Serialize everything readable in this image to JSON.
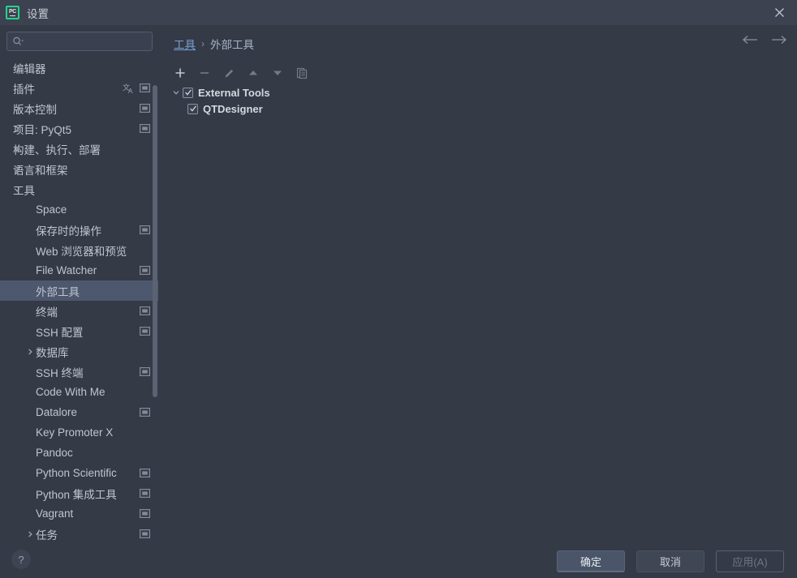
{
  "window": {
    "title": "设置",
    "app_icon": "pycharm-logo",
    "app_icon_text": "PC",
    "close_icon": "close-icon"
  },
  "search": {
    "value": "",
    "placeholder": "",
    "icon": "search-icon"
  },
  "breadcrumb": {
    "parent": "工具",
    "separator": "›",
    "current": "外部工具"
  },
  "nav": {
    "back_icon": "arrow-left-icon",
    "forward_icon": "arrow-right-icon"
  },
  "sidebar": {
    "items": [
      {
        "label": "编辑器",
        "indent": 0,
        "chevron": "none",
        "badge": false,
        "translate": false,
        "selected": false
      },
      {
        "label": "插件",
        "indent": 0,
        "chevron": "none",
        "badge": true,
        "translate": true,
        "selected": false
      },
      {
        "label": "版本控制",
        "indent": 0,
        "chevron": "collapsed",
        "badge": true,
        "translate": false,
        "selected": false
      },
      {
        "label": "项目: PyQt5",
        "indent": 0,
        "chevron": "collapsed",
        "badge": true,
        "translate": false,
        "selected": false
      },
      {
        "label": "构建、执行、部署",
        "indent": 0,
        "chevron": "collapsed",
        "badge": false,
        "translate": false,
        "selected": false
      },
      {
        "label": "语言和框架",
        "indent": 0,
        "chevron": "collapsed",
        "badge": false,
        "translate": false,
        "selected": false
      },
      {
        "label": "工具",
        "indent": 0,
        "chevron": "expanded",
        "badge": false,
        "translate": false,
        "selected": false
      },
      {
        "label": "Space",
        "indent": 1,
        "chevron": "none",
        "badge": false,
        "translate": false,
        "selected": false
      },
      {
        "label": "保存时的操作",
        "indent": 1,
        "chevron": "none",
        "badge": true,
        "translate": false,
        "selected": false
      },
      {
        "label": "Web 浏览器和预览",
        "indent": 1,
        "chevron": "none",
        "badge": false,
        "translate": false,
        "selected": false
      },
      {
        "label": "File Watcher",
        "indent": 1,
        "chevron": "none",
        "badge": true,
        "translate": false,
        "selected": false
      },
      {
        "label": "外部工具",
        "indent": 1,
        "chevron": "none",
        "badge": false,
        "translate": false,
        "selected": true
      },
      {
        "label": "终端",
        "indent": 1,
        "chevron": "none",
        "badge": true,
        "translate": false,
        "selected": false
      },
      {
        "label": "SSH 配置",
        "indent": 1,
        "chevron": "none",
        "badge": true,
        "translate": false,
        "selected": false
      },
      {
        "label": "数据库",
        "indent": 1,
        "chevron": "collapsed",
        "badge": false,
        "translate": false,
        "selected": false
      },
      {
        "label": "SSH 终端",
        "indent": 1,
        "chevron": "none",
        "badge": true,
        "translate": false,
        "selected": false
      },
      {
        "label": "Code With Me",
        "indent": 1,
        "chevron": "none",
        "badge": false,
        "translate": false,
        "selected": false
      },
      {
        "label": "Datalore",
        "indent": 1,
        "chevron": "none",
        "badge": true,
        "translate": false,
        "selected": false
      },
      {
        "label": "Key Promoter X",
        "indent": 1,
        "chevron": "none",
        "badge": false,
        "translate": false,
        "selected": false
      },
      {
        "label": "Pandoc",
        "indent": 1,
        "chevron": "none",
        "badge": false,
        "translate": false,
        "selected": false
      },
      {
        "label": "Python Scientific",
        "indent": 1,
        "chevron": "none",
        "badge": true,
        "translate": false,
        "selected": false
      },
      {
        "label": "Python 集成工具",
        "indent": 1,
        "chevron": "none",
        "badge": true,
        "translate": false,
        "selected": false
      },
      {
        "label": "Vagrant",
        "indent": 1,
        "chevron": "none",
        "badge": true,
        "translate": false,
        "selected": false
      },
      {
        "label": "任务",
        "indent": 1,
        "chevron": "collapsed",
        "badge": true,
        "translate": false,
        "selected": false
      }
    ],
    "help_label": "?"
  },
  "toolbar": {
    "buttons": [
      {
        "name": "add-button",
        "icon": "plus-icon",
        "enabled": true
      },
      {
        "name": "remove-button",
        "icon": "minus-icon",
        "enabled": false
      },
      {
        "name": "edit-button",
        "icon": "pencil-icon",
        "enabled": false
      },
      {
        "name": "move-up-button",
        "icon": "arrow-up-icon",
        "enabled": false
      },
      {
        "name": "move-down-button",
        "icon": "arrow-down-icon",
        "enabled": false
      },
      {
        "name": "copy-button",
        "icon": "copy-icon",
        "enabled": false
      }
    ]
  },
  "tree": {
    "root": {
      "label": "External Tools",
      "checked": true,
      "expanded": true
    },
    "children": [
      {
        "label": "QTDesigner",
        "checked": true
      }
    ]
  },
  "footer": {
    "ok_label": "确定",
    "cancel_label": "取消",
    "apply_label": "应用(A)"
  },
  "colors": {
    "background": "#343a46",
    "titlebar": "#3c4250",
    "selection": "#4d586e",
    "link": "#7a9fd4",
    "accent_green": "#21d789",
    "text": "#bfc5d0"
  }
}
